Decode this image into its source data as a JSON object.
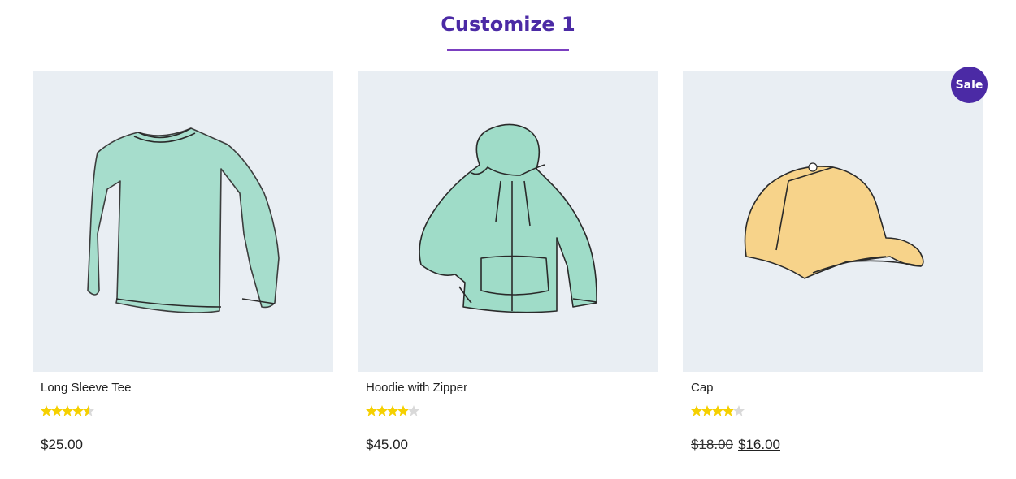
{
  "section": {
    "title": "Customize 1"
  },
  "colors": {
    "accent": "#4b2aa5",
    "underline": "#7b3fc0",
    "star": "#f5d000",
    "star_empty": "#d9d9d9",
    "image_bg": "#e9eef3"
  },
  "products": [
    {
      "name": "Long Sleeve Tee",
      "rating": 4.5,
      "price": "$25.00",
      "image_icon": "long-sleeve-tee-illustration"
    },
    {
      "name": "Hoodie with Zipper",
      "rating": 4,
      "price": "$45.00",
      "image_icon": "hoodie-illustration"
    },
    {
      "name": "Cap",
      "rating": 4,
      "price_old": "$18.00",
      "price": "$16.00",
      "badge": "Sale",
      "image_icon": "cap-illustration"
    }
  ]
}
